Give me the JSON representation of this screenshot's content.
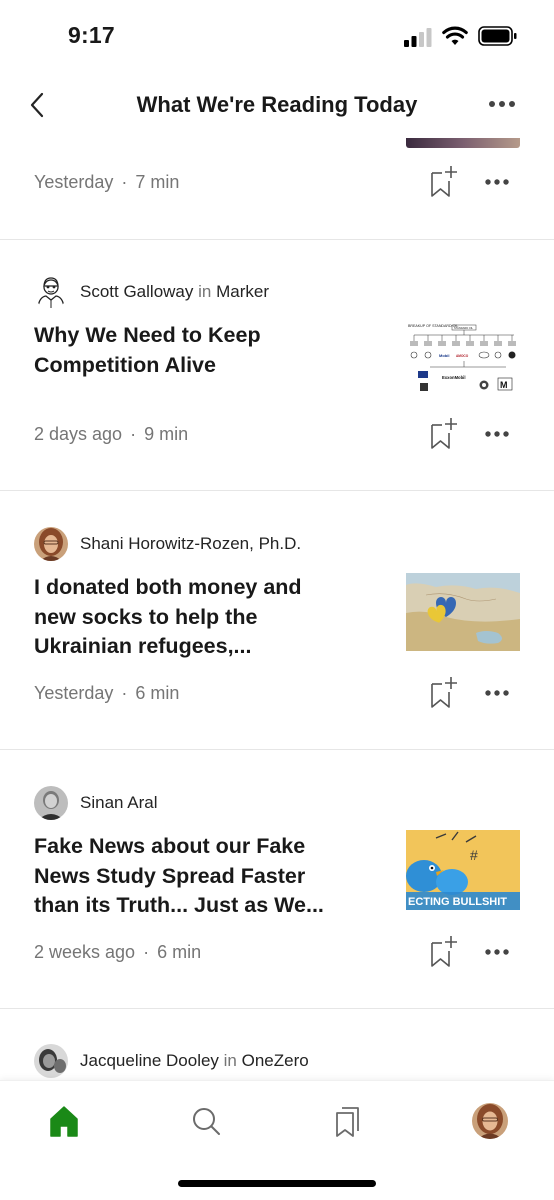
{
  "status_bar": {
    "time": "9:17"
  },
  "header": {
    "title": "What We're Reading Today"
  },
  "top_partial": {
    "meta_date": "Yesterday",
    "meta_read": "7 min"
  },
  "articles": [
    {
      "author": "Scott Galloway",
      "in_word": "in",
      "publication": "Marker",
      "headline_line1": "Why We Need to Keep",
      "headline_line2": "Competition Alive",
      "headline_line3": "",
      "date": "2 days ago",
      "read_time": "9 min",
      "thumb_labels": [
        "BREAKUP OF STANDARD OIL",
        "STANDARD OIL",
        "Mobil",
        "AMOCO",
        "ExxonMobil",
        "M"
      ]
    },
    {
      "author": "Shani Horowitz-Rozen, Ph.D.",
      "in_word": "",
      "publication": "",
      "headline_line1": "I donated both money and",
      "headline_line2": "new socks to help the",
      "headline_line3": "Ukrainian refugees,...",
      "date": "Yesterday",
      "read_time": "6 min"
    },
    {
      "author": "Sinan Aral",
      "in_word": "",
      "publication": "",
      "headline_line1": "Fake News about our Fake",
      "headline_line2": "News Study Spread Faster",
      "headline_line3": "than its Truth... Just as We...",
      "date": "2 weeks ago",
      "read_time": "6 min",
      "thumb_caption": "ECTING BULLSHIT"
    },
    {
      "author": "Jacqueline Dooley",
      "in_word": "in",
      "publication": "OneZero"
    }
  ],
  "icons": {
    "back": "chevron-left-icon",
    "more": "more-horizontal-icon",
    "bookmark": "bookmark-add-icon",
    "home": "home-icon",
    "search": "search-icon",
    "library": "library-icon",
    "profile": "avatar"
  },
  "colors": {
    "accent": "#1a8917",
    "meta": "#757575",
    "text": "#191919"
  }
}
